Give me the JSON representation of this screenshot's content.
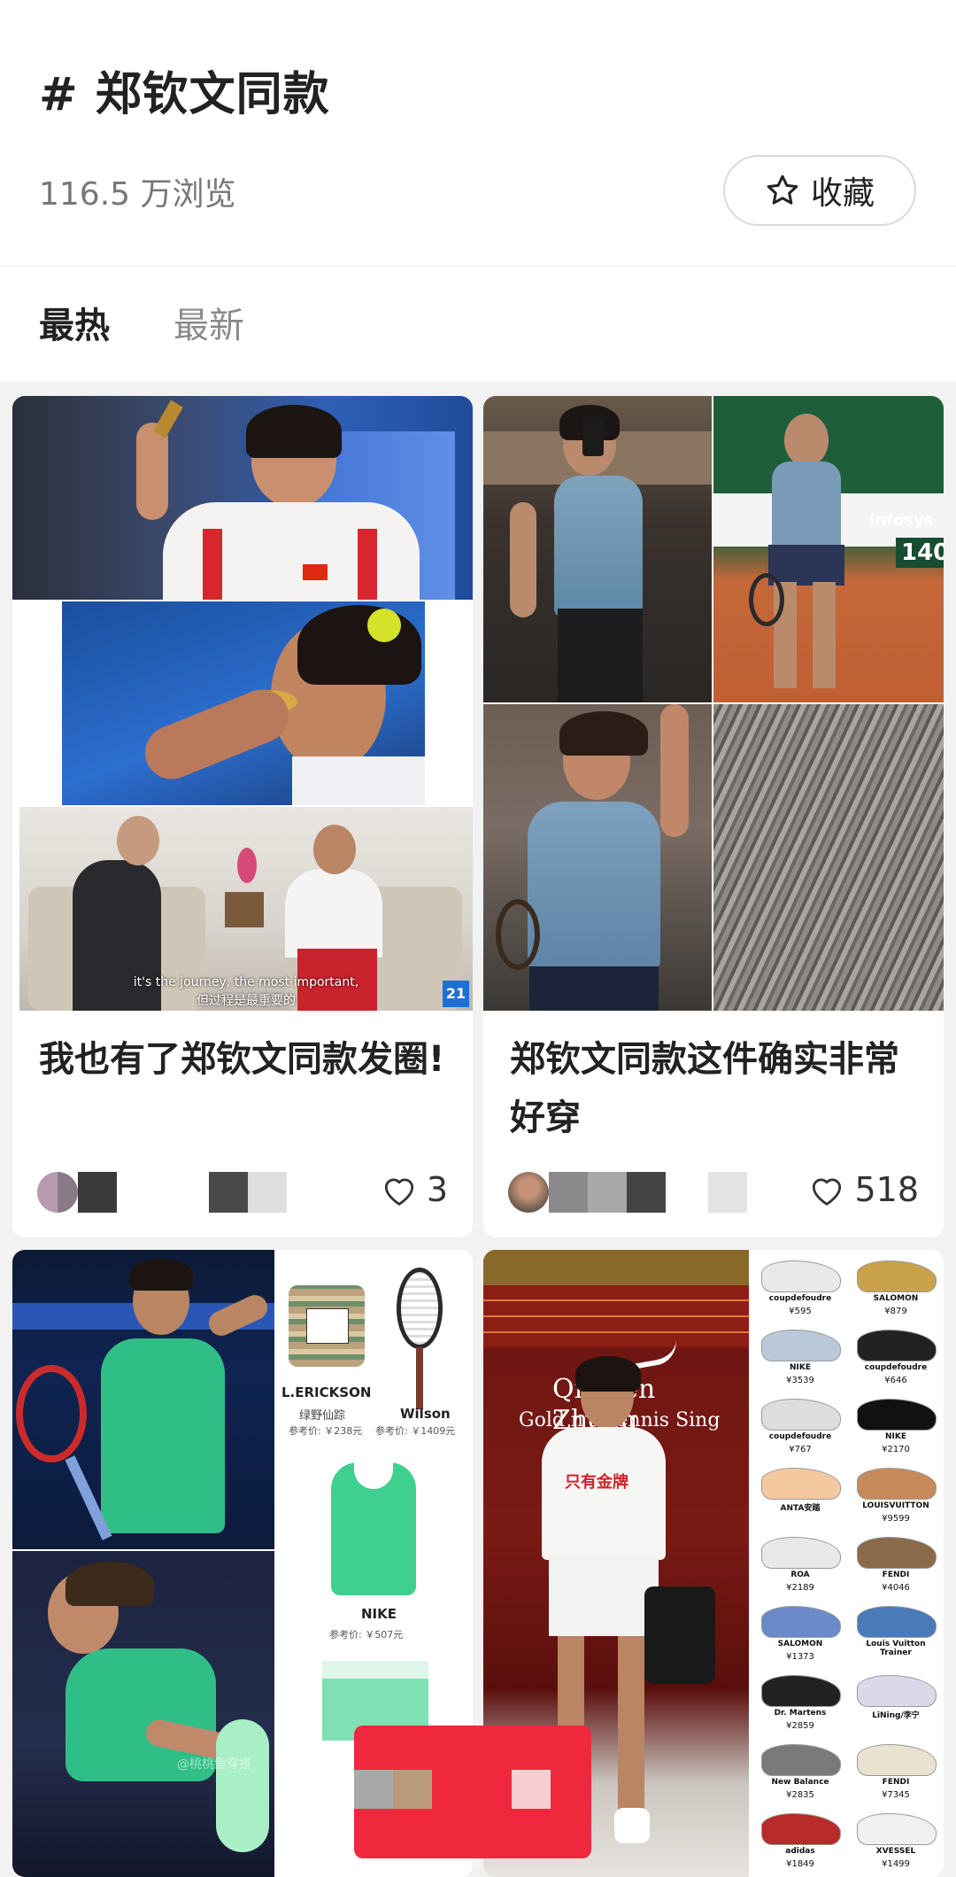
{
  "header": {
    "title": "# 郑钦文同款",
    "views": "116.5 万浏览",
    "collect_label": "收藏"
  },
  "tabs": [
    {
      "label": "最热",
      "active": true
    },
    {
      "label": "最新",
      "active": false
    }
  ],
  "posts": [
    {
      "title": "我也有了郑钦文同款发圈!",
      "likes": "3",
      "image_caption_en": "it's the journey, the most important,",
      "image_caption_zh": "但过程是最重要的",
      "image_badge": "21"
    },
    {
      "title": "郑钦文同款这件确实非常好穿",
      "likes": "518",
      "image_scoreboard": "140",
      "image_brand": "infosys"
    },
    {
      "products": [
        {
          "brand": "L.ERICKSON",
          "name": "绿野仙踪",
          "price": "参考价: ￥238元"
        },
        {
          "brand": "Wilson",
          "price": "参考价: ￥1409元"
        },
        {
          "brand": "NIKE",
          "price": "参考价: ￥507元"
        }
      ],
      "watermark": "@桃桃鱼穿搭"
    },
    {
      "banner_text": "Qinwen Zheng",
      "banner_sub": "Gold  n's Tennis Sing",
      "shirt_text": "只有金牌",
      "shoes": [
        {
          "name": "coupdefoudre",
          "price": "¥595"
        },
        {
          "name": "SALOMON",
          "price": "¥879"
        },
        {
          "name": "NIKE",
          "price": "¥3539"
        },
        {
          "name": "coupdefoudre",
          "price": "¥646"
        },
        {
          "name": "coupdefoudre",
          "price": "¥767"
        },
        {
          "name": "NIKE",
          "price": "¥2170"
        },
        {
          "name": "ANTA安踏",
          "price": ""
        },
        {
          "name": "LOUISVUITTON",
          "price": "¥9599"
        },
        {
          "name": "ROA",
          "price": "¥2189"
        },
        {
          "name": "FENDI",
          "price": "¥4046"
        },
        {
          "name": "SALOMON",
          "price": "¥1373"
        },
        {
          "name": "Louis Vuitton Trainer",
          "price": ""
        },
        {
          "name": "Dr. Martens",
          "price": "¥2859"
        },
        {
          "name": "LiNing/李宁",
          "price": ""
        },
        {
          "name": "New Balance",
          "price": "¥2835"
        },
        {
          "name": "FENDI",
          "price": "¥7345"
        },
        {
          "name": "adidas",
          "price": "¥1849"
        },
        {
          "name": "XVESSEL",
          "price": "¥1499"
        }
      ]
    }
  ],
  "colors": {
    "accent_red": "#f0283d",
    "tennis_green": "#2fbf86",
    "header_bg": "#ffffff",
    "page_bg": "#f2f2f2"
  }
}
